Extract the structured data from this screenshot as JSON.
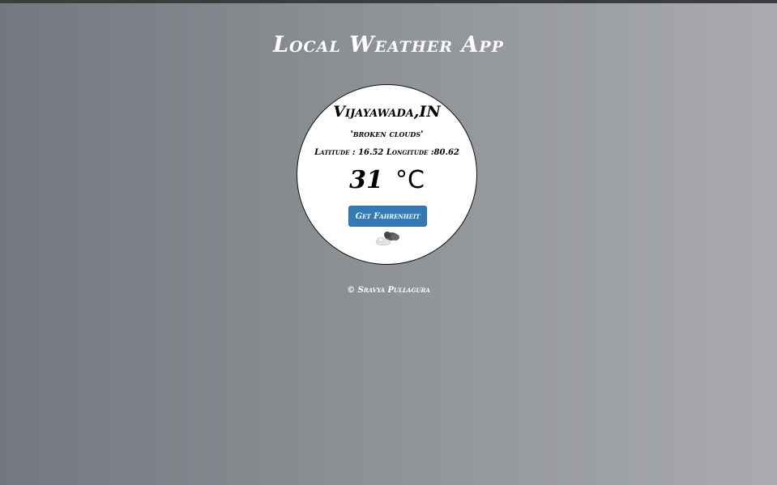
{
  "app": {
    "title": "Local Weather App"
  },
  "weather": {
    "location": "Vijayawada,IN",
    "description": "'broken clouds'",
    "coordinates_text": "Latitude : 16.52 Longitude :80.62",
    "temperature": "31",
    "unit": "°C",
    "toggle_label": "Get Fahrenheit",
    "icon": "broken-clouds-icon"
  },
  "footer": {
    "text": "© Sravya Pullagura"
  },
  "colors": {
    "button": "#337ab7",
    "card": "#ffffff",
    "text_light": "#ffffff"
  }
}
